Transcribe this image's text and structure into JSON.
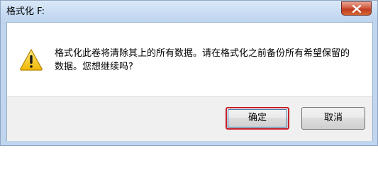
{
  "window": {
    "title": "格式化 F:"
  },
  "dialog": {
    "icon": "warning-icon",
    "message": "格式化此卷将清除其上的所有数据。请在格式化之前备份所有希望保留的数据。您想继续吗?"
  },
  "buttons": {
    "ok_label": "确定",
    "cancel_label": "取消"
  },
  "colors": {
    "titlebar": "#c9ddf3",
    "close_button": "#c7452c",
    "focus_border": "#c8202a",
    "button_bar": "#f0f0f0",
    "warning_fill": "#f5c518"
  }
}
